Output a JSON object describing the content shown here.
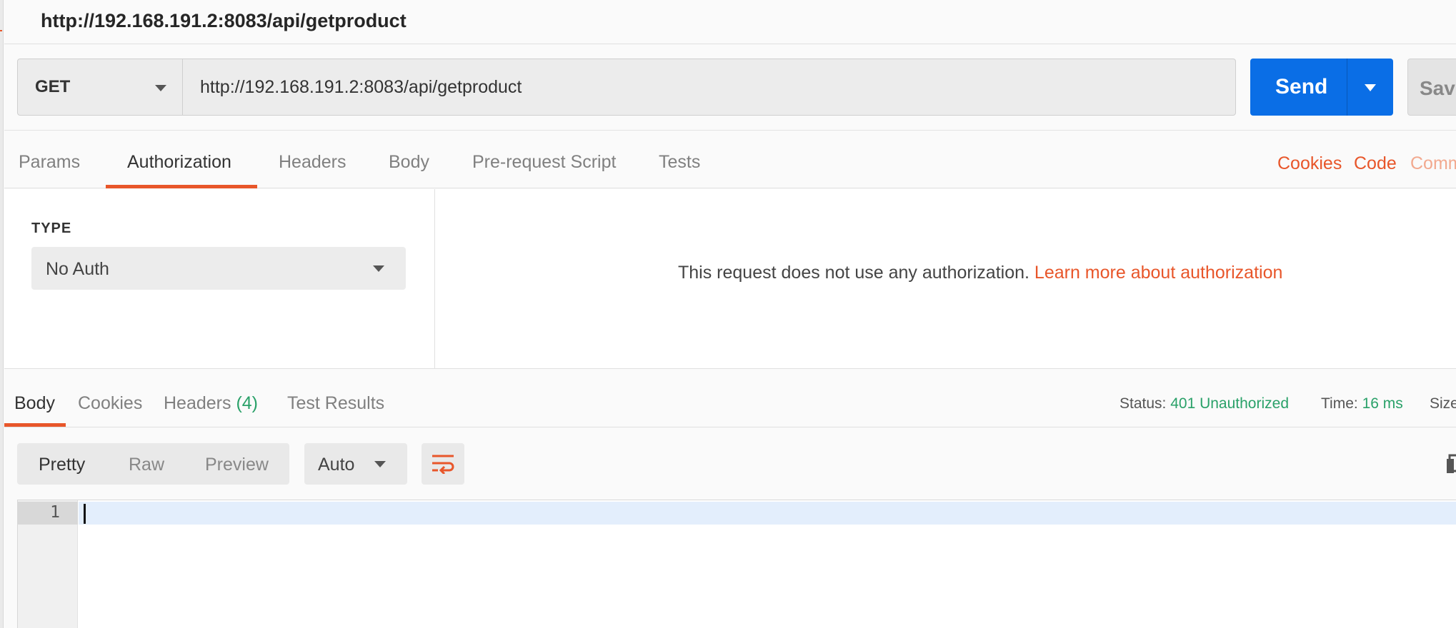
{
  "window": {
    "title": "http://192.168.191.2:8083/api/getproduct"
  },
  "request": {
    "method": "GET",
    "url": "http://192.168.191.2:8083/api/getproduct",
    "send_label": "Send",
    "save_label": "Save"
  },
  "request_tabs": {
    "items": [
      {
        "label": "Params",
        "active": false
      },
      {
        "label": "Authorization",
        "active": true
      },
      {
        "label": "Headers",
        "active": false
      },
      {
        "label": "Body",
        "active": false
      },
      {
        "label": "Pre-request Script",
        "active": false
      },
      {
        "label": "Tests",
        "active": false
      }
    ],
    "right_links": {
      "cookies": "Cookies",
      "code": "Code",
      "comments": "Comm"
    }
  },
  "authorization": {
    "type_label": "TYPE",
    "type_value": "No Auth",
    "message": "This request does not use any authorization.",
    "learn_more": "Learn more about authorization"
  },
  "response": {
    "tabs": {
      "body": "Body",
      "cookies": "Cookies",
      "headers": "Headers",
      "headers_count": "(4)",
      "test_results": "Test Results"
    },
    "status_label": "Status:",
    "status_value": "401 Unauthorized",
    "time_label": "Time:",
    "time_value": "16 ms",
    "size_label": "Size"
  },
  "viewer": {
    "formats": [
      "Pretty",
      "Raw",
      "Preview"
    ],
    "active_format": "Pretty",
    "language": "Auto",
    "line_number": "1"
  },
  "colors": {
    "accent": "#e8562a",
    "send": "#0a6ee6",
    "success": "#2aa169"
  },
  "icons": {
    "wrap": "wrap-lines-icon",
    "copy": "copy-icon",
    "caret": "chevron-down-icon"
  }
}
